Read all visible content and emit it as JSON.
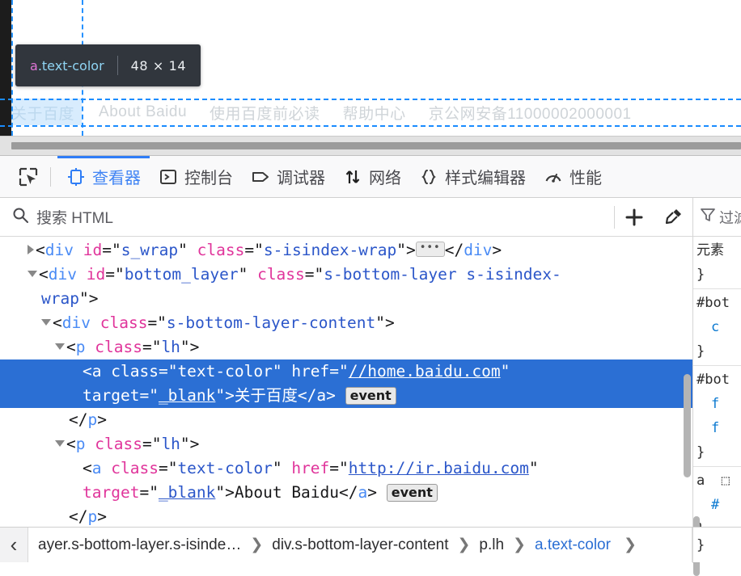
{
  "page": {
    "inspector_tooltip": {
      "tag": "a",
      "class": ".text-color",
      "dimensions": "48 × 14"
    },
    "footer_links": [
      "关于百度",
      "About Baidu",
      "使用百度前必读",
      "帮助中心",
      "京公网安备11000002000001"
    ],
    "highlight_color": "#1a8cff"
  },
  "devtools": {
    "picker_icon": "element-picker-icon",
    "tabs": [
      {
        "label": "查看器",
        "icon": "inspector-icon",
        "active": true
      },
      {
        "label": "控制台",
        "icon": "console-icon",
        "active": false
      },
      {
        "label": "调试器",
        "icon": "debugger-icon",
        "active": false
      },
      {
        "label": "网络",
        "icon": "network-icon",
        "active": false
      },
      {
        "label": "样式编辑器",
        "icon": "style-editor-icon",
        "active": false
      },
      {
        "label": "性能",
        "icon": "performance-icon",
        "active": false
      }
    ],
    "active_tab_color": "#2f7df6",
    "search": {
      "placeholder": "搜索 HTML",
      "value": "",
      "add_node_label": "+",
      "eyedropper_label": "eyedropper-icon"
    },
    "rules_header": "过滤",
    "markup": {
      "lines": [
        {
          "indent": 2,
          "twisty": "closed",
          "selected": false,
          "parts": [
            {
              "t": "punct",
              "v": "<"
            },
            {
              "t": "tagname",
              "v": "div"
            },
            {
              "t": "txt",
              "v": " "
            },
            {
              "t": "attrname",
              "v": "id"
            },
            {
              "t": "punct",
              "v": "=\""
            },
            {
              "t": "attrval",
              "v": "s_wrap"
            },
            {
              "t": "punct",
              "v": "\" "
            },
            {
              "t": "attrname",
              "v": "class"
            },
            {
              "t": "punct",
              "v": "=\""
            },
            {
              "t": "attrval",
              "v": "s-isindex-wrap"
            },
            {
              "t": "punct",
              "v": "\">"
            },
            {
              "t": "badge-ellipsis",
              "v": "…"
            },
            {
              "t": "punct",
              "v": "</"
            },
            {
              "t": "tagname",
              "v": "div"
            },
            {
              "t": "punct",
              "v": ">"
            }
          ]
        },
        {
          "indent": 2,
          "twisty": "open",
          "selected": false,
          "parts": [
            {
              "t": "punct",
              "v": "<"
            },
            {
              "t": "tagname",
              "v": "div"
            },
            {
              "t": "txt",
              "v": " "
            },
            {
              "t": "attrname",
              "v": "id"
            },
            {
              "t": "punct",
              "v": "=\""
            },
            {
              "t": "attrval",
              "v": "bottom_layer"
            },
            {
              "t": "punct",
              "v": "\" "
            },
            {
              "t": "attrname",
              "v": "class"
            },
            {
              "t": "punct",
              "v": "=\""
            },
            {
              "t": "attrval",
              "v": "s-bottom-layer s-isindex-"
            }
          ]
        },
        {
          "indent": 3,
          "twisty": "none",
          "selected": false,
          "parts": [
            {
              "t": "attrval",
              "v": "wrap"
            },
            {
              "t": "punct",
              "v": "\">"
            }
          ]
        },
        {
          "indent": 3,
          "twisty": "open",
          "selected": false,
          "parts": [
            {
              "t": "punct",
              "v": "<"
            },
            {
              "t": "tagname",
              "v": "div"
            },
            {
              "t": "txt",
              "v": " "
            },
            {
              "t": "attrname",
              "v": "class"
            },
            {
              "t": "punct",
              "v": "=\""
            },
            {
              "t": "attrval",
              "v": "s-bottom-layer-content"
            },
            {
              "t": "punct",
              "v": "\">"
            }
          ]
        },
        {
          "indent": 4,
          "twisty": "open",
          "selected": false,
          "parts": [
            {
              "t": "punct",
              "v": "<"
            },
            {
              "t": "tagname",
              "v": "p"
            },
            {
              "t": "txt",
              "v": " "
            },
            {
              "t": "attrname",
              "v": "class"
            },
            {
              "t": "punct",
              "v": "=\""
            },
            {
              "t": "attrval",
              "v": "lh"
            },
            {
              "t": "punct",
              "v": "\">"
            }
          ]
        },
        {
          "indent": 6,
          "twisty": "none",
          "selected": true,
          "parts": [
            {
              "t": "punct",
              "v": "<"
            },
            {
              "t": "tagname",
              "v": "a"
            },
            {
              "t": "txt",
              "v": " "
            },
            {
              "t": "attrname",
              "v": "class"
            },
            {
              "t": "punct",
              "v": "=\""
            },
            {
              "t": "attrval",
              "v": "text-color"
            },
            {
              "t": "punct",
              "v": "\" "
            },
            {
              "t": "attrname",
              "v": "href"
            },
            {
              "t": "punct",
              "v": "=\""
            },
            {
              "t": "link",
              "v": "//home.baidu.com"
            },
            {
              "t": "punct",
              "v": "\""
            }
          ]
        },
        {
          "indent": 6,
          "twisty": "none",
          "selected": true,
          "parts": [
            {
              "t": "attrname",
              "v": "target"
            },
            {
              "t": "punct",
              "v": "=\""
            },
            {
              "t": "link",
              "v": "_blank"
            },
            {
              "t": "punct",
              "v": "\">"
            },
            {
              "t": "txt",
              "v": "关于百度"
            },
            {
              "t": "punct",
              "v": "</"
            },
            {
              "t": "tagname",
              "v": "a"
            },
            {
              "t": "punct",
              "v": "> "
            },
            {
              "t": "badge-event",
              "v": "event"
            }
          ]
        },
        {
          "indent": 5,
          "twisty": "none",
          "selected": false,
          "parts": [
            {
              "t": "punct",
              "v": "</"
            },
            {
              "t": "tagname",
              "v": "p"
            },
            {
              "t": "punct",
              "v": ">"
            }
          ]
        },
        {
          "indent": 4,
          "twisty": "open",
          "selected": false,
          "parts": [
            {
              "t": "punct",
              "v": "<"
            },
            {
              "t": "tagname",
              "v": "p"
            },
            {
              "t": "txt",
              "v": " "
            },
            {
              "t": "attrname",
              "v": "class"
            },
            {
              "t": "punct",
              "v": "=\""
            },
            {
              "t": "attrval",
              "v": "lh"
            },
            {
              "t": "punct",
              "v": "\">"
            }
          ]
        },
        {
          "indent": 6,
          "twisty": "none",
          "selected": false,
          "parts": [
            {
              "t": "punct",
              "v": "<"
            },
            {
              "t": "tagname",
              "v": "a"
            },
            {
              "t": "txt",
              "v": " "
            },
            {
              "t": "attrname",
              "v": "class"
            },
            {
              "t": "punct",
              "v": "=\""
            },
            {
              "t": "attrval",
              "v": "text-color"
            },
            {
              "t": "punct",
              "v": "\" "
            },
            {
              "t": "attrname",
              "v": "href"
            },
            {
              "t": "punct",
              "v": "=\""
            },
            {
              "t": "link",
              "v": "http://ir.baidu.com"
            },
            {
              "t": "punct",
              "v": "\""
            }
          ]
        },
        {
          "indent": 6,
          "twisty": "none",
          "selected": false,
          "parts": [
            {
              "t": "attrname",
              "v": "target"
            },
            {
              "t": "punct",
              "v": "=\""
            },
            {
              "t": "link",
              "v": "_blank"
            },
            {
              "t": "punct",
              "v": "\">"
            },
            {
              "t": "txt",
              "v": "About Baidu"
            },
            {
              "t": "punct",
              "v": "</"
            },
            {
              "t": "tagname",
              "v": "a"
            },
            {
              "t": "punct",
              "v": "> "
            },
            {
              "t": "badge-event",
              "v": "event"
            }
          ]
        },
        {
          "indent": 5,
          "twisty": "none",
          "selected": false,
          "parts": [
            {
              "t": "punct",
              "v": "</"
            },
            {
              "t": "tagname",
              "v": "p"
            },
            {
              "t": "punct",
              "v": ">"
            }
          ]
        }
      ]
    },
    "rules": [
      {
        "lines": [
          {
            "type": "selector",
            "text": "元素"
          },
          {
            "type": "brace",
            "text": "}"
          }
        ]
      },
      {
        "lines": [
          {
            "type": "selector",
            "text": "#bot"
          },
          {
            "type": "prop",
            "text": "c"
          },
          {
            "type": "brace",
            "text": "}"
          }
        ]
      },
      {
        "lines": [
          {
            "type": "selector",
            "text": "#bot"
          },
          {
            "type": "prop",
            "text": "f"
          },
          {
            "type": "prop",
            "text": "f"
          },
          {
            "type": "brace",
            "text": "}"
          }
        ]
      },
      {
        "lines": [
          {
            "type": "selector",
            "text": "a  ⬚"
          },
          {
            "type": "prop",
            "text": "#"
          },
          {
            "type": "brace",
            "text": "}"
          }
        ]
      }
    ],
    "breadcrumb": {
      "prev_arrow": "‹",
      "next_arrow": "›",
      "items": [
        {
          "label": "ayer.s-bottom-layer.s-isinde…",
          "current": false
        },
        {
          "label": "div.s-bottom-layer-content",
          "current": false
        },
        {
          "label": "p.lh",
          "current": false
        },
        {
          "label": "a.text-color",
          "current": true
        }
      ],
      "separator": "❯",
      "right_stub": "}"
    }
  }
}
